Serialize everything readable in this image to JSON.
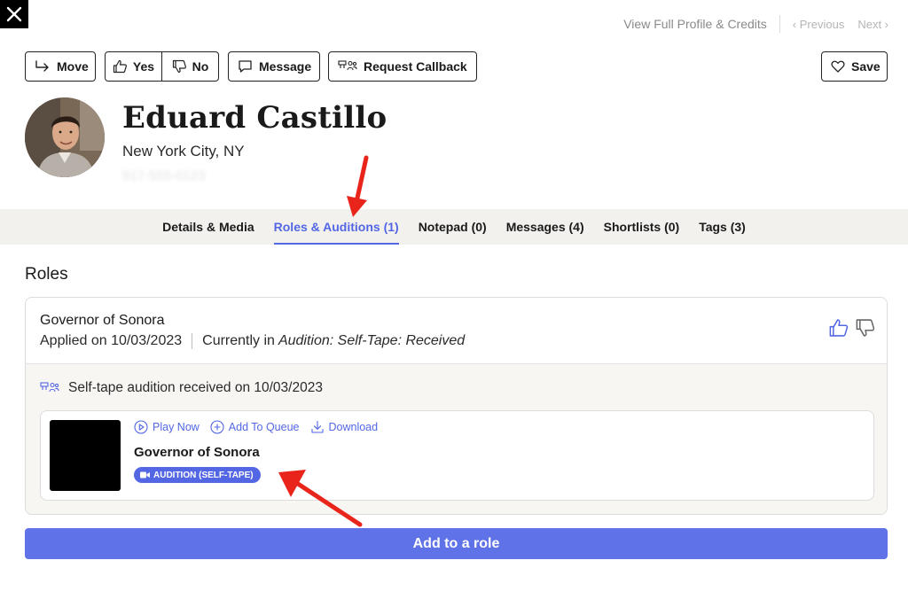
{
  "header": {
    "view_full_profile": "View Full Profile & Credits",
    "previous": "‹ Previous",
    "next": "Next ›"
  },
  "toolbar": {
    "move": "Move",
    "yes": "Yes",
    "no": "No",
    "message": "Message",
    "request_callback": "Request Callback",
    "save": "Save"
  },
  "profile": {
    "name": "Eduard Castillo",
    "location": "New York City, NY",
    "redacted_phone": "917-555-0123"
  },
  "tabs": [
    {
      "label": "Details & Media"
    },
    {
      "label": "Roles & Auditions (1)"
    },
    {
      "label": "Notepad (0)"
    },
    {
      "label": "Messages (4)"
    },
    {
      "label": "Shortlists (0)"
    },
    {
      "label": "Tags (3)"
    }
  ],
  "roles": {
    "heading": "Roles",
    "items": [
      {
        "title": "Governor of Sonora",
        "applied": "Applied on 10/03/2023",
        "currently_prefix": "Currently in",
        "status": "Audition: Self-Tape: Received",
        "selftape_text": "Self-tape audition received on 10/03/2023",
        "media": {
          "play_now": "Play Now",
          "add_to_queue": "Add To Queue",
          "download": "Download",
          "title": "Governor of Sonora",
          "badge": "AUDITION (SELF-TAPE)"
        }
      }
    ]
  },
  "add_to_role": "Add to a role",
  "colors": {
    "accent": "#5367e4",
    "button_primary": "#5f72e8",
    "tab_bar_bg": "#f2f1ee",
    "annotation_arrow": "#e8241b"
  }
}
